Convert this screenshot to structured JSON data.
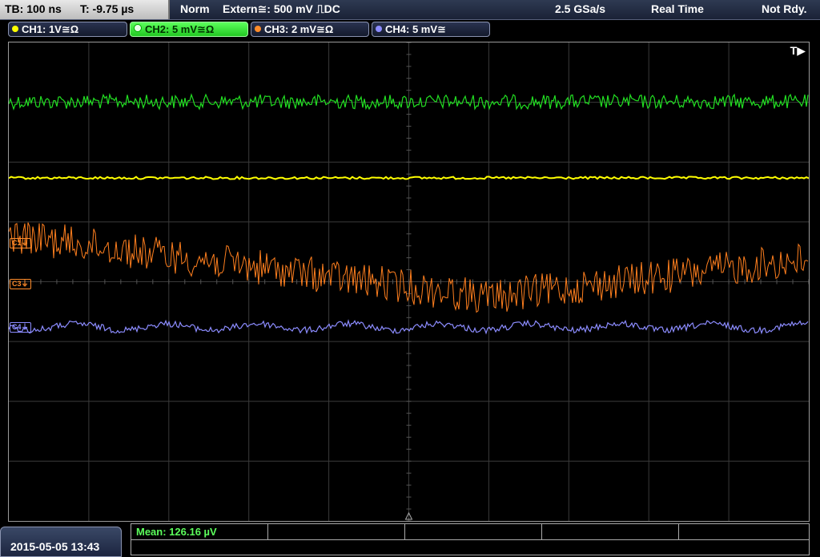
{
  "topbar": {
    "timebase": "TB: 100 ns",
    "trigger_time": "T: -9.75 µs",
    "mode": "Norm",
    "trigger_source": "Extern≅: 500 mV ⎍DC",
    "sample_rate": "2.5 GSa/s",
    "acq_mode": "Real Time",
    "status": "Not Rdy."
  },
  "channels": [
    {
      "label": "CH1: 1V≅Ω",
      "color": "#ffff00"
    },
    {
      "label": "CH2: 5 mV≅Ω",
      "color": "#00d000"
    },
    {
      "label": "CH3: 2 mV≅Ω",
      "color": "#ff8c2a"
    },
    {
      "label": "CH4: 5 mV≅",
      "color": "#8c8cff"
    }
  ],
  "screen": {
    "trigger_marker": "T▶",
    "markers": {
      "c1": "C1⏚",
      "c3": "C3⏚",
      "c4": "C4⏚"
    }
  },
  "bottom": {
    "datetime": "2015-05-05 13:43",
    "mean": "Mean: 126.16 µV"
  }
}
